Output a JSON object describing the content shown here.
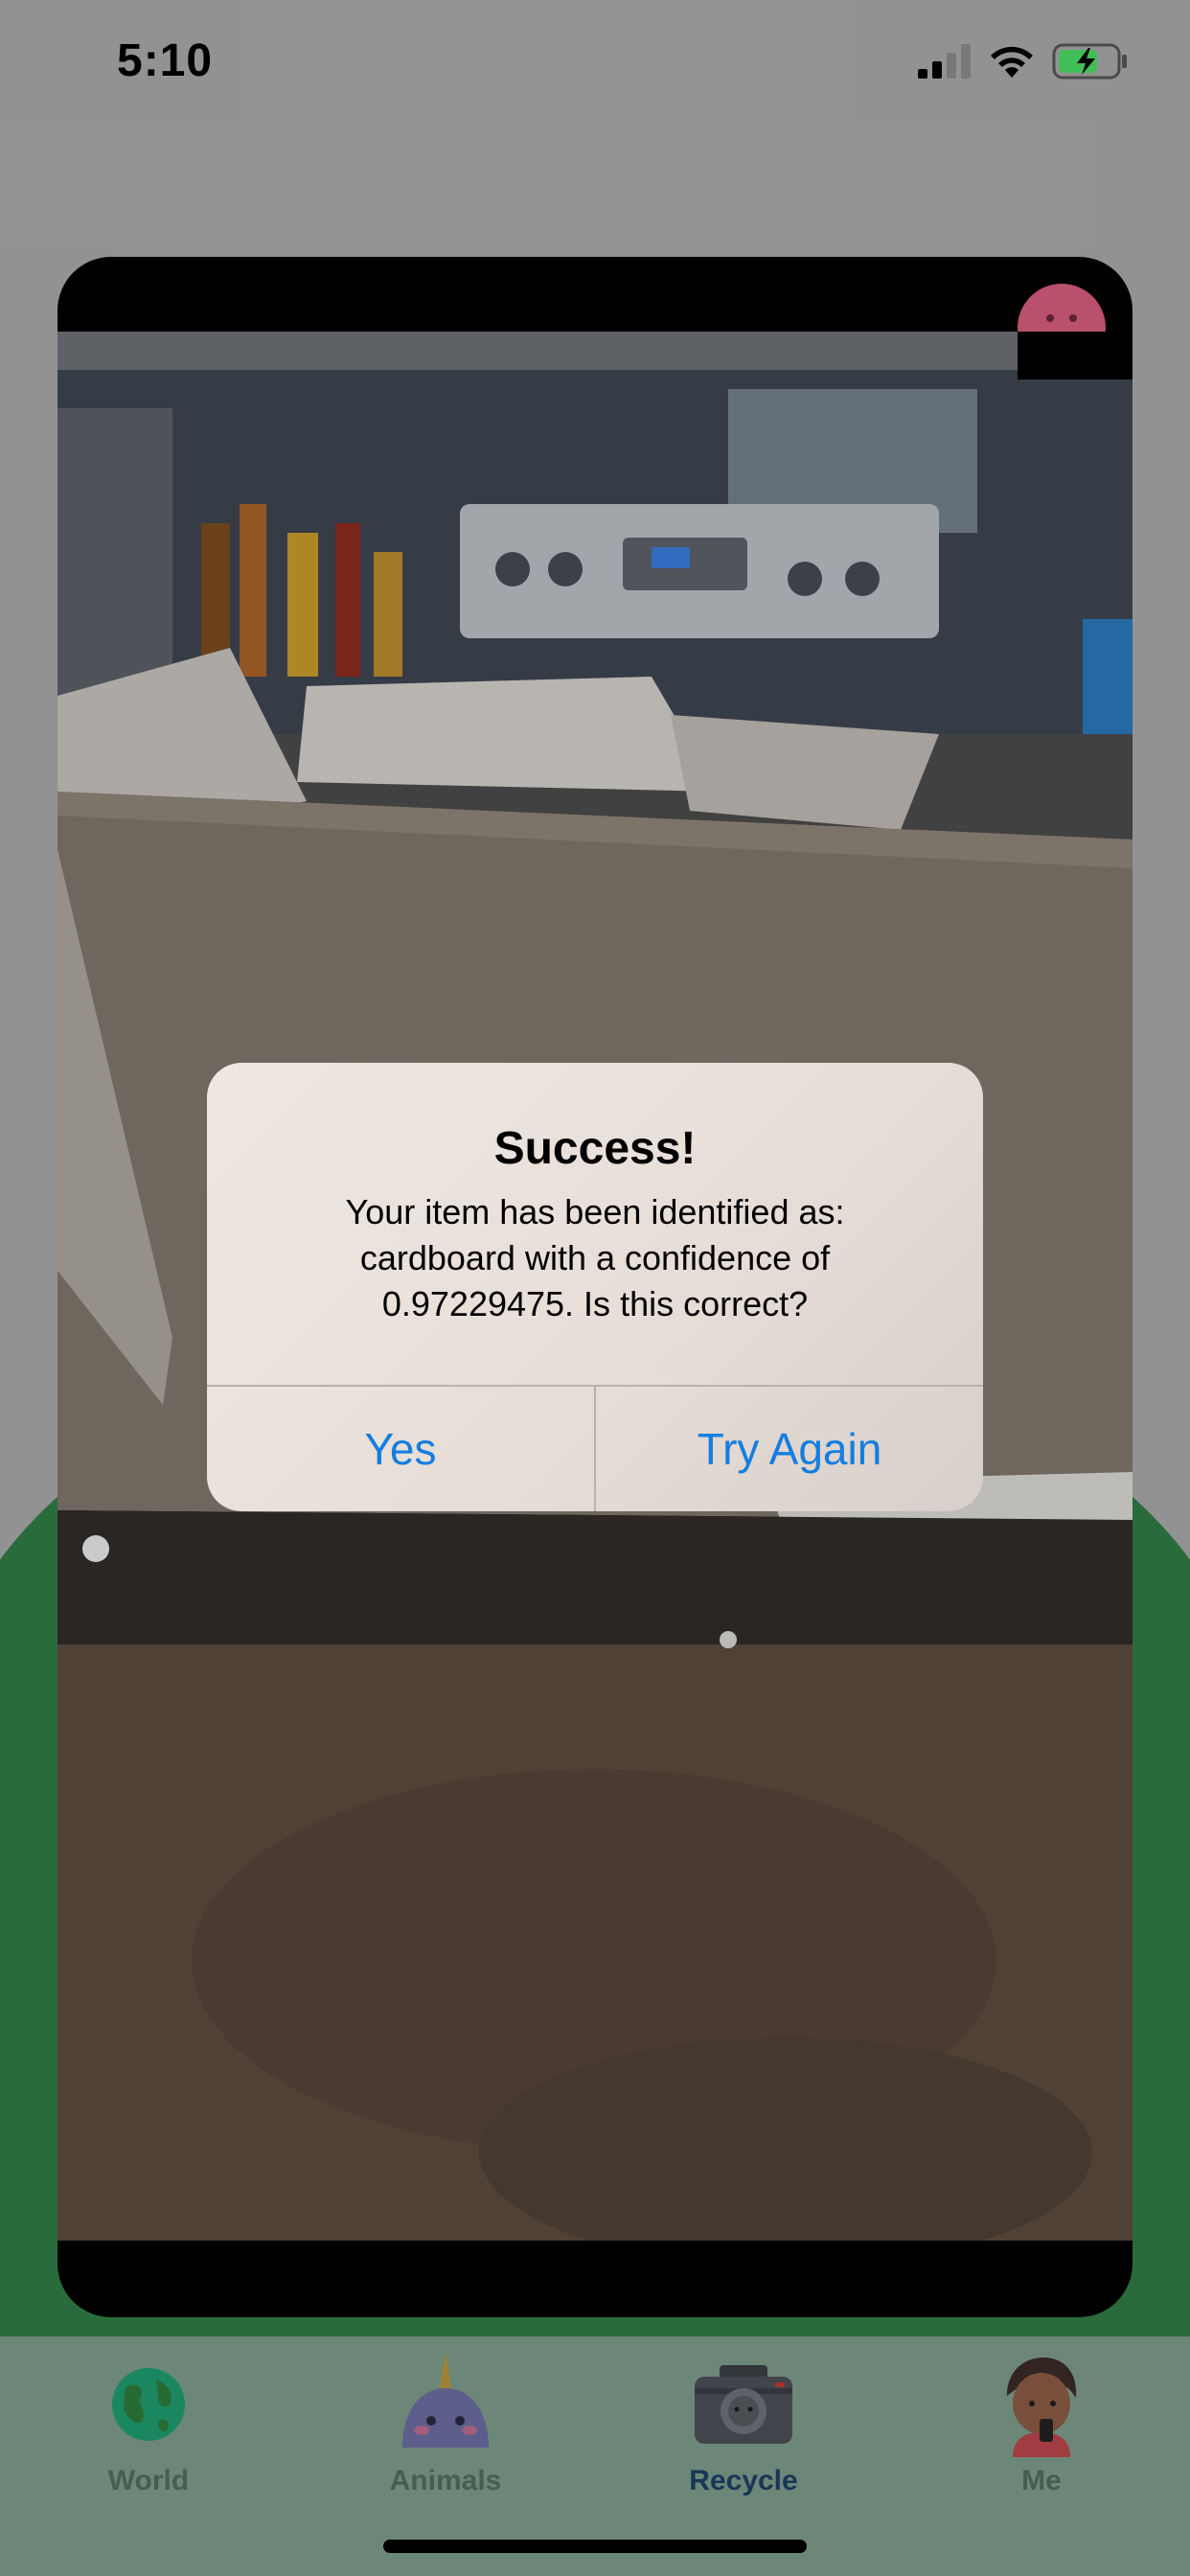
{
  "status_bar": {
    "time": "5:10"
  },
  "alert": {
    "title": "Success!",
    "message": "Your item has been identified as: cardboard with a confidence of 0.97229475. Is this correct?",
    "yes_label": "Yes",
    "try_again_label": "Try Again"
  },
  "tabs": [
    {
      "label": "World",
      "icon": "globe-icon",
      "active": false
    },
    {
      "label": "Animals",
      "icon": "narwhal-icon",
      "active": false
    },
    {
      "label": "Recycle",
      "icon": "camera-icon",
      "active": true
    },
    {
      "label": "Me",
      "icon": "avatar-icon",
      "active": false
    }
  ],
  "colors": {
    "accent_link": "#147ee0",
    "tab_bar": "#7b9a88",
    "green_background": "#2f7a43",
    "close_button": "#d35c7c",
    "active_tab_label": "#1c3f63"
  }
}
